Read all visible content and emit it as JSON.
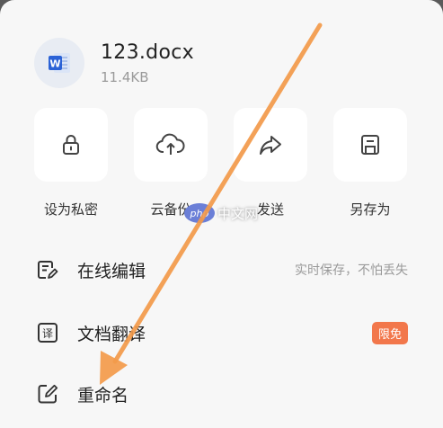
{
  "file": {
    "name": "123.docx",
    "size": "11.4KB",
    "icon_letter": "W"
  },
  "actions": [
    {
      "label": "设为私密",
      "icon": "lock-icon"
    },
    {
      "label": "云备份",
      "icon": "cloud-upload-icon"
    },
    {
      "label": "发送",
      "icon": "share-arrow-icon"
    },
    {
      "label": "另存为",
      "icon": "save-icon"
    }
  ],
  "menu": {
    "online_edit": {
      "label": "在线编辑",
      "hint": "实时保存，不怕丢失",
      "icon": "edit-document-icon"
    },
    "translate": {
      "label": "文档翻译",
      "badge": "限免",
      "icon": "translate-icon"
    },
    "rename": {
      "label": "重命名",
      "icon": "rename-pencil-icon"
    }
  },
  "watermark": {
    "logo": "php",
    "text": "中文网"
  },
  "colors": {
    "sheet_bg": "#f7f7f7",
    "tile_bg": "#ffffff",
    "word_blue": "#2b62d6",
    "badge": "#f2774b",
    "arrow": "#f39a4a"
  }
}
